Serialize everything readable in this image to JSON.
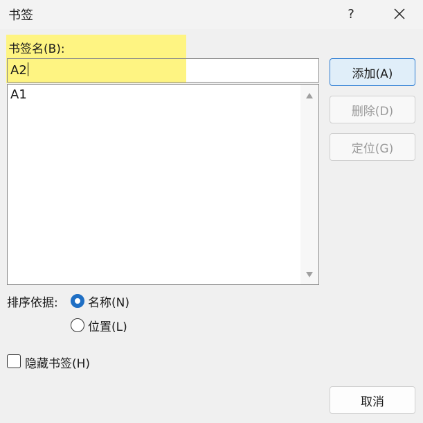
{
  "window": {
    "title": "书签",
    "help_label": "?",
    "close_icon": "close-icon"
  },
  "bookmark_name": {
    "label": "书签名(B):",
    "value": "A2"
  },
  "bookmark_list": {
    "items": [
      "A1"
    ]
  },
  "buttons": {
    "add": "添加(A)",
    "delete": "删除(D)",
    "goto": "定位(G)",
    "cancel": "取消"
  },
  "sort_by": {
    "label": "排序依据:",
    "options": [
      {
        "label": "名称(N)",
        "selected": true
      },
      {
        "label": "位置(L)",
        "selected": false
      }
    ]
  },
  "hidden_bookmarks": {
    "label": "隐藏书签(H)",
    "checked": false
  },
  "colors": {
    "highlight": "#fff475",
    "accent": "#1f6fc4",
    "primary_button_border": "#2b7cd3"
  }
}
